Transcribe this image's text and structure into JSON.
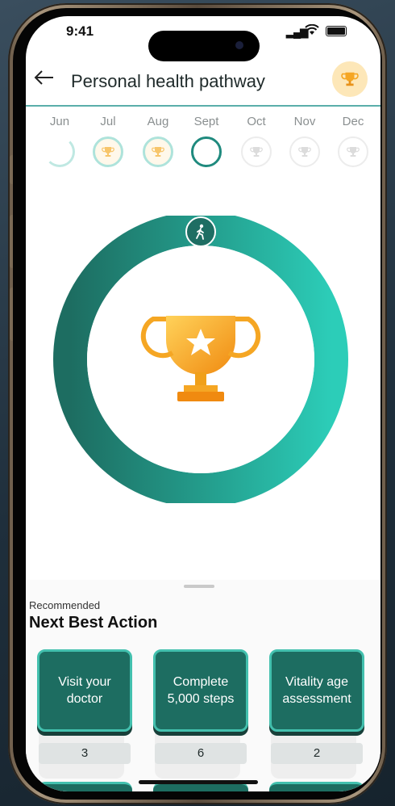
{
  "status_bar": {
    "time": "9:41"
  },
  "header": {
    "title": "Personal health pathway"
  },
  "months": [
    {
      "label": "Jun",
      "state": "partial"
    },
    {
      "label": "Jul",
      "state": "achieved"
    },
    {
      "label": "Aug",
      "state": "achieved"
    },
    {
      "label": "Sept",
      "state": "current"
    },
    {
      "label": "Oct",
      "state": "future"
    },
    {
      "label": "Nov",
      "state": "future"
    },
    {
      "label": "Dec",
      "state": "future"
    }
  ],
  "progress": {
    "fraction": 1.0,
    "icon": "walking-person-icon"
  },
  "recommended": {
    "eyebrow": "Recommended",
    "heading": "Next Best Action",
    "actions": [
      {
        "label_line1": "Visit your",
        "label_line2": "doctor",
        "count": "3"
      },
      {
        "label_line1": "Complete",
        "label_line2": "5,000 steps",
        "count": "6"
      },
      {
        "label_line1": "Vitality age",
        "label_line2": "assessment",
        "count": "2"
      }
    ]
  },
  "colors": {
    "teal_dark": "#1d6d61",
    "teal_light": "#2ccdb8",
    "gold": "#f5a623"
  }
}
